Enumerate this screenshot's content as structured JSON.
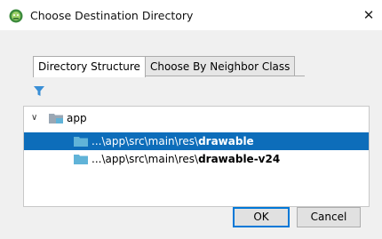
{
  "window": {
    "title": "Choose Destination Directory",
    "close_glyph": "✕",
    "title_icon": "android-studio-icon"
  },
  "tabs": [
    {
      "label": "Directory Structure",
      "active": true
    },
    {
      "label": "Choose By Neighbor Class",
      "active": false
    }
  ],
  "toolbar": {
    "filter_icon": "filter-icon"
  },
  "tree": {
    "root": {
      "label": "app",
      "expanded": true,
      "chevron": "∨"
    },
    "items": [
      {
        "prefix": "...\\app\\src\\main\\res\\",
        "name": "drawable",
        "selected": true
      },
      {
        "prefix": "...\\app\\src\\main\\res\\",
        "name": "drawable-v24",
        "selected": false
      }
    ]
  },
  "buttons": {
    "ok": "OK",
    "cancel": "Cancel"
  },
  "colors": {
    "selection": "#0d6dba",
    "folder": "#60b3d8",
    "filter": "#3a8fd6",
    "accent": "#0078d7"
  }
}
